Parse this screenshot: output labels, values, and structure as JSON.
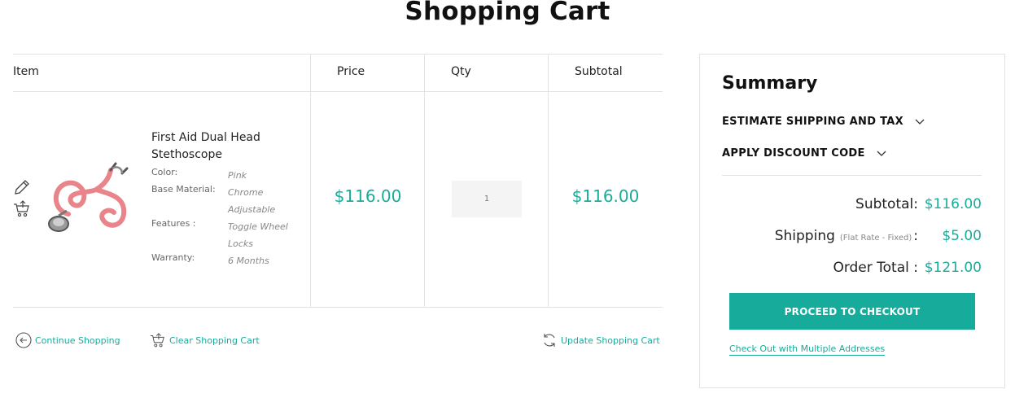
{
  "page": {
    "title": "Shopping Cart"
  },
  "cart": {
    "headers": {
      "item": "Item",
      "price": "Price",
      "qty": "Qty",
      "subtotal": "Subtotal"
    },
    "items": [
      {
        "name": "First Aid Dual Head Stethoscope",
        "options": [
          {
            "label": "Color:",
            "value": "Pink"
          },
          {
            "label": "Base Material:",
            "value": "Chrome Adjustable"
          },
          {
            "label": "Features :",
            "value": "Toggle Wheel Locks"
          },
          {
            "label": "Warranty:",
            "value": "6 Months"
          }
        ],
        "price": "$116.00",
        "qty": "1",
        "subtotal": "$116.00"
      }
    ],
    "actions": {
      "continue": "Continue Shopping",
      "clear": "Clear Shopping Cart",
      "update": "Update Shopping Cart"
    }
  },
  "summary": {
    "title": "Summary",
    "estimate_label": "ESTIMATE SHIPPING AND TAX",
    "discount_label": "APPLY DISCOUNT CODE",
    "subtotal_label": "Subtotal:",
    "subtotal_value": "$116.00",
    "shipping_label": "Shipping",
    "shipping_note": "(Flat Rate - Fixed)",
    "shipping_colon": ":",
    "shipping_value": "$5.00",
    "order_total_label": "Order Total :",
    "order_total_value": "$121.00",
    "checkout_button": "PROCEED TO CHECKOUT",
    "multi_address_link": "Check Out with Multiple Addresses"
  },
  "icons": {
    "edit": "pencil-icon",
    "move_to_cart": "cart-icon",
    "continue": "arrow-left-circle-icon",
    "clear": "cart-icon",
    "update": "refresh-icon",
    "chevron": "chevron-down-icon"
  },
  "colors": {
    "accent": "#1aab9b",
    "button": "#17ab9b",
    "border": "#e3e3e3"
  }
}
